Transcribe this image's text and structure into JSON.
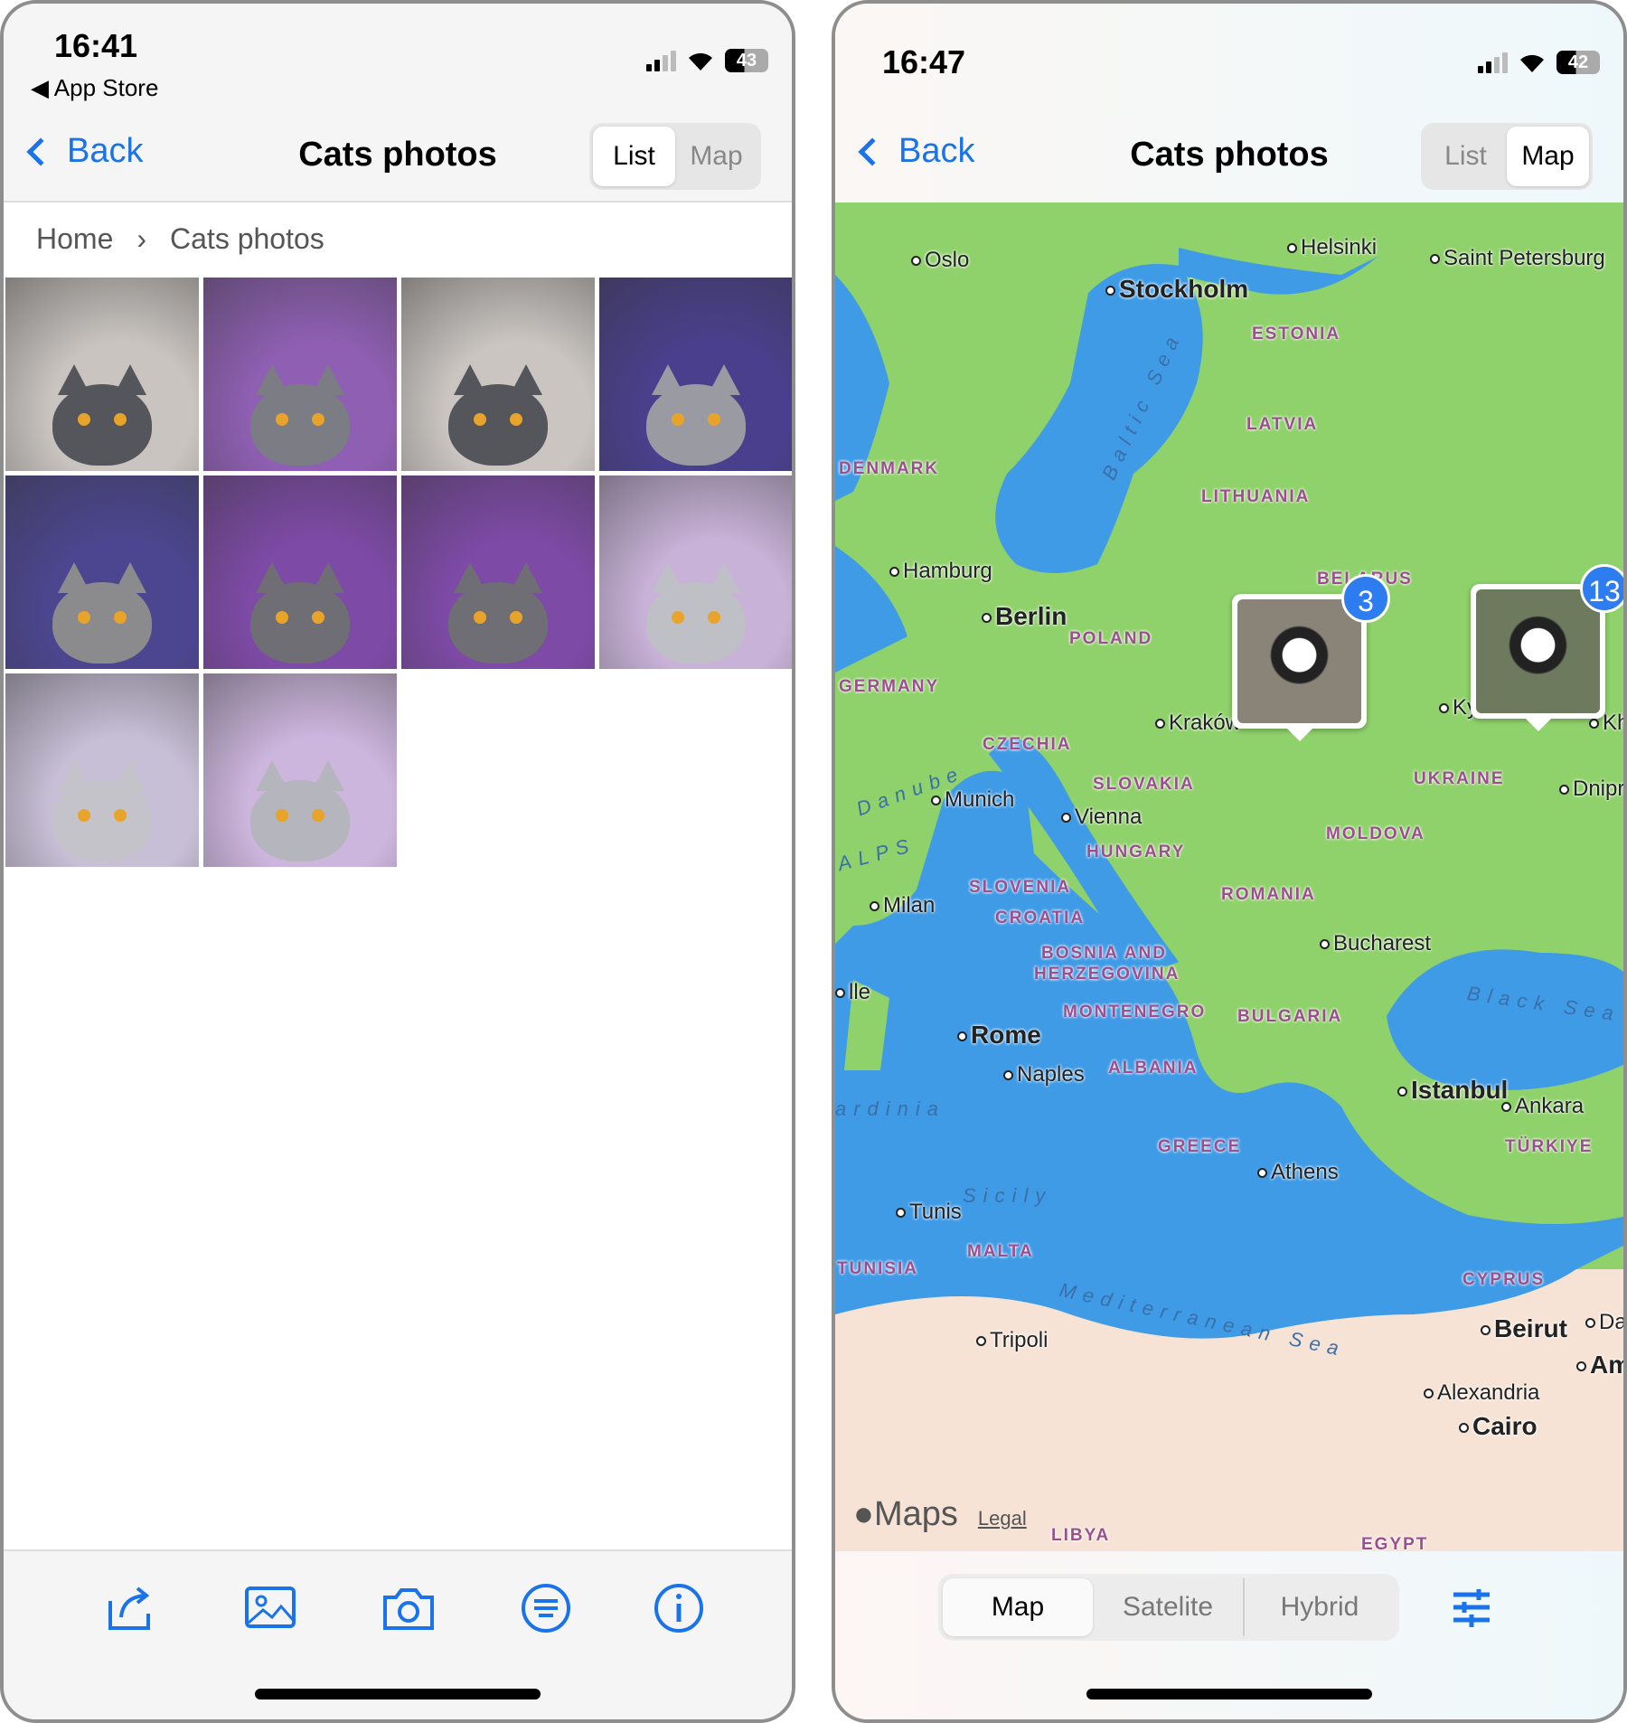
{
  "left": {
    "status": {
      "time": "16:41",
      "back_app": "App Store",
      "battery": "43"
    },
    "nav": {
      "back": "Back",
      "title": "Cats photos",
      "segments": [
        "List",
        "Map"
      ],
      "selected": "List"
    },
    "breadcrumb": {
      "items": [
        "Home",
        "Cats photos"
      ],
      "separator": "›"
    },
    "photos": [
      {
        "bg": "#c9c4c0",
        "cat": "#55565c"
      },
      {
        "bg": "#8e5fb2",
        "cat": "#7c7d84"
      },
      {
        "bg": "#cac5c1",
        "cat": "#55565c"
      },
      {
        "bg": "#4a3f8c",
        "cat": "#9a9ba2"
      },
      {
        "bg": "#4c4690",
        "cat": "#8b8b8e"
      },
      {
        "bg": "#7d4aa6",
        "cat": "#6e6e74"
      },
      {
        "bg": "#7d4aa6",
        "cat": "#6e6e74"
      },
      {
        "bg": "#c8b2d8",
        "cat": "#bfbfc6"
      },
      {
        "bg": "#c7bfd6",
        "cat": "#c3c3c9"
      },
      {
        "bg": "#cdb6de",
        "cat": "#b5b5bd"
      }
    ],
    "toolbar": [
      "share-icon",
      "photo-icon",
      "camera-icon",
      "list-icon",
      "info-icon"
    ]
  },
  "right": {
    "status": {
      "time": "16:47",
      "battery": "42"
    },
    "nav": {
      "back": "Back",
      "title": "Cats photos",
      "segments": [
        "List",
        "Map"
      ],
      "selected": "Map"
    },
    "map": {
      "labels": [
        {
          "t": "Oslo",
          "k": "city"
        },
        {
          "t": "Helsinki",
          "k": "city"
        },
        {
          "t": "Saint Petersburg",
          "k": "city"
        },
        {
          "t": "Stockholm",
          "k": "city big"
        },
        {
          "t": "ESTONIA",
          "k": "country"
        },
        {
          "t": "LATVIA",
          "k": "country"
        },
        {
          "t": "DENMARK",
          "k": "country"
        },
        {
          "t": "LITHUANIA",
          "k": "country"
        },
        {
          "t": "Hamburg",
          "k": "city"
        },
        {
          "t": "Berlin",
          "k": "city big"
        },
        {
          "t": "BELARUS",
          "k": "country"
        },
        {
          "t": "POLAND",
          "k": "country"
        },
        {
          "t": "GERMANY",
          "k": "country"
        },
        {
          "t": "Kraków",
          "k": "city"
        },
        {
          "t": "Kyi",
          "k": "city"
        },
        {
          "t": "Kha",
          "k": "city"
        },
        {
          "t": "CZECHIA",
          "k": "country"
        },
        {
          "t": "UKRAINE",
          "k": "country"
        },
        {
          "t": "Dnipro",
          "k": "city"
        },
        {
          "t": "Munich",
          "k": "city"
        },
        {
          "t": "SLOVAKIA",
          "k": "country"
        },
        {
          "t": "Vienna",
          "k": "city"
        },
        {
          "t": "HUNGARY",
          "k": "country"
        },
        {
          "t": "MOLDOVA",
          "k": "country"
        },
        {
          "t": "Milan",
          "k": "city"
        },
        {
          "t": "SLOVENIA",
          "k": "country"
        },
        {
          "t": "ROMANIA",
          "k": "country"
        },
        {
          "t": "CROATIA",
          "k": "country"
        },
        {
          "t": "Bucharest",
          "k": "city"
        },
        {
          "t": "BOSNIA AND",
          "k": "country"
        },
        {
          "t": "HERZEGOVINA",
          "k": "country"
        },
        {
          "t": "Black Sea",
          "k": "sea"
        },
        {
          "t": "MONTENEGRO",
          "k": "country"
        },
        {
          "t": "BULGARIA",
          "k": "country"
        },
        {
          "t": "Rome",
          "k": "city big"
        },
        {
          "t": "Naples",
          "k": "city"
        },
        {
          "t": "ALBANIA",
          "k": "country"
        },
        {
          "t": "Istanbul",
          "k": "city big"
        },
        {
          "t": "Ankara",
          "k": "city"
        },
        {
          "t": "GREECE",
          "k": "country"
        },
        {
          "t": "TÜRKIYE",
          "k": "country"
        },
        {
          "t": "Athens",
          "k": "city"
        },
        {
          "t": "Sicily",
          "k": "sea"
        },
        {
          "t": "Tunis",
          "k": "city"
        },
        {
          "t": "MALTA",
          "k": "country"
        },
        {
          "t": "TUNISIA",
          "k": "country"
        },
        {
          "t": "CYPRUS",
          "k": "country"
        },
        {
          "t": "Mediterranean Sea",
          "k": "sea"
        },
        {
          "t": "Beirut",
          "k": "city big"
        },
        {
          "t": "Tripoli",
          "k": "city"
        },
        {
          "t": "Alexandria",
          "k": "city"
        },
        {
          "t": "Cairo",
          "k": "city big"
        },
        {
          "t": "LIBYA",
          "k": "country"
        },
        {
          "t": "EGYPT",
          "k": "country"
        },
        {
          "t": "Baltic Sea",
          "k": "sea"
        },
        {
          "t": "Danube",
          "k": "sea"
        },
        {
          "t": "ALPS",
          "k": "sea"
        },
        {
          "t": "lle",
          "k": "city"
        },
        {
          "t": "ardinia",
          "k": "sea"
        },
        {
          "t": "Dar",
          "k": "city"
        },
        {
          "t": "Am",
          "k": "city big"
        }
      ],
      "pins": [
        {
          "count": "3",
          "bg": "#8a8378"
        },
        {
          "count": "13",
          "bg": "#6d7a5e"
        }
      ],
      "attribution": "Maps",
      "legal": "Legal"
    },
    "map_types": [
      "Map",
      "Satelite",
      "Hybrid"
    ],
    "selected_map_type": "Map",
    "filter_icon": "sliders-icon"
  },
  "colors": {
    "accent": "#1a73e8",
    "sea": "#3f9be6",
    "land": "#8fd16a",
    "desert": "#f6e3d6"
  }
}
